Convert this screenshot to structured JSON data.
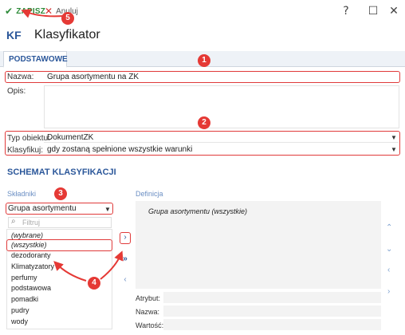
{
  "toolbar": {
    "save_label": "ZAPISZ",
    "cancel_label": "Anuluj",
    "help_icon": "?",
    "maximize_icon": "☐",
    "close_icon": "✕"
  },
  "header": {
    "badge": "KF",
    "title": "Klasyfikator"
  },
  "tabs": [
    {
      "label": "PODSTAWOWE"
    }
  ],
  "form": {
    "name_label": "Nazwa:",
    "name_value": "Grupa asortymentu na ZK",
    "description_label": "Opis:",
    "object_type_label": "Typ obiektu:",
    "object_type_value": "DokumentZK",
    "classify_label": "Klasyfikuj:",
    "classify_value": "gdy zostaną spełnione wszystkie warunki"
  },
  "schema": {
    "title": "SCHEMAT KLASYFIKACJI",
    "components_label": "Składniki",
    "definition_label": "Definicja",
    "component_select": "Grupa asortymentu",
    "filter_placeholder": "Filtruj",
    "items": [
      "(wybrane)",
      "(wszystkie)",
      "dezodoranty",
      "Klimatyzatory",
      "perfumy",
      "podstawowa",
      "pomadki",
      "pudry",
      "wody"
    ],
    "selected_item": "(wszystkie)",
    "definition_text": "Grupa asortymentu (wszystkie)",
    "attribute_label": "Atrybut:",
    "name_label": "Nazwa:",
    "value_label": "Wartość:"
  },
  "badges": [
    "1",
    "2",
    "3",
    "4",
    "5"
  ],
  "colors": {
    "accent": "#2b579a",
    "highlight": "#e03a3a",
    "save": "#2e8b3a"
  }
}
